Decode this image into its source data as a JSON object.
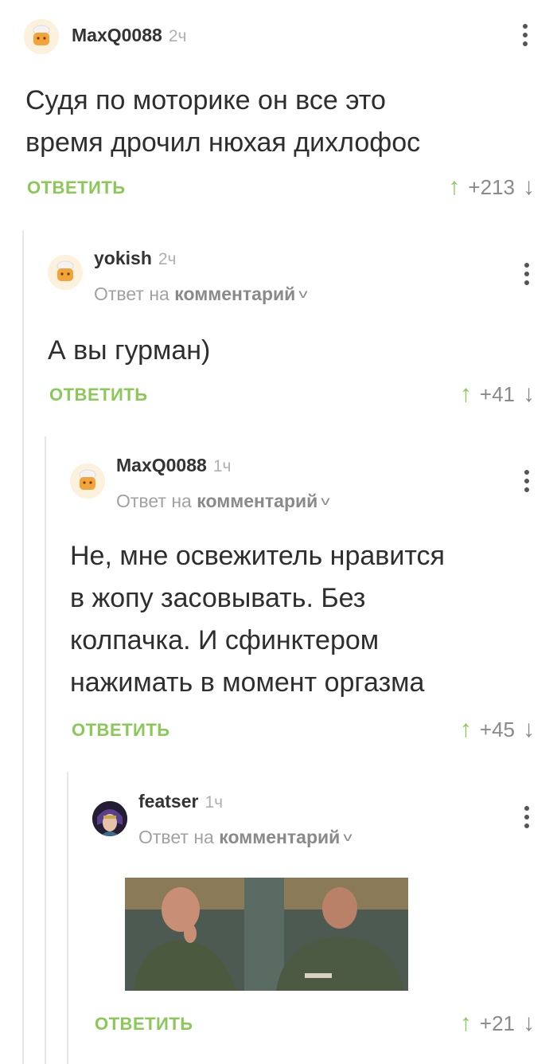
{
  "comments": [
    {
      "username": "MaxQ0088",
      "time": "2ч",
      "text_lines": [
        "Судя по моторике он все это",
        "время дрочил нюхая дихлофос"
      ],
      "reply_label": "ОТВЕТИТЬ",
      "rating": "+213"
    },
    {
      "username": "yokish",
      "time": "2ч",
      "reply_to_prefix": "Ответ на",
      "reply_to_target": "комментарий",
      "text_lines": [
        "А вы гурман)"
      ],
      "reply_label": "ОТВЕТИТЬ",
      "rating": "+41"
    },
    {
      "username": "MaxQ0088",
      "time": "1ч",
      "reply_to_prefix": "Ответ на",
      "reply_to_target": "комментарий",
      "text_lines": [
        "Не, мне освежитель нравится",
        "в жопу засовывать. Без",
        "колпачка. И сфинктером",
        "нажимать в момент оргазма"
      ],
      "reply_label": "ОТВЕТИТЬ",
      "rating": "+45"
    },
    {
      "username": "featser",
      "time": "1ч",
      "reply_to_prefix": "Ответ на",
      "reply_to_target": "комментарий",
      "reply_label": "ОТВЕТИТЬ",
      "rating": "+21"
    }
  ],
  "icons": {
    "upvote": "arrow-up-icon",
    "downvote": "arrow-down-icon",
    "more": "more-vertical-icon",
    "chevron": "chevron-down-icon"
  },
  "colors": {
    "accent": "#8ac858",
    "muted": "#a2a2a2",
    "thread": "#e6e6e6"
  }
}
